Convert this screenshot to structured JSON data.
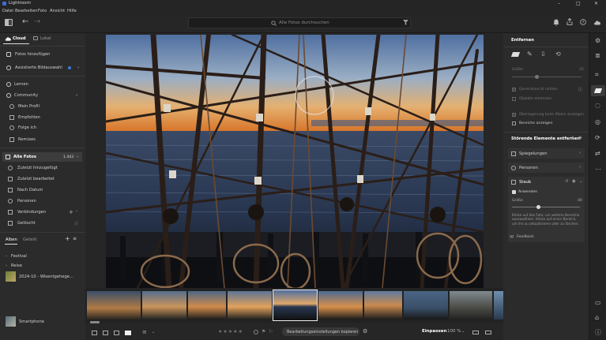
{
  "app": {
    "title": "Lightroom"
  },
  "menu": [
    "Datei",
    "Bearbeiten",
    "Foto",
    "Ansicht",
    "Hilfe"
  ],
  "search": {
    "placeholder": "Alle Fotos durchsuchen"
  },
  "left": {
    "tabs": {
      "cloud": "Cloud",
      "local": "Lokal"
    },
    "add_photos": "Fotos hinzufügen",
    "assisted": "Assistierte Bildauswahl",
    "learn": "Lernen",
    "community": "Community",
    "community_items": [
      "Mein Profil",
      "Empfohlen",
      "Folge ich",
      "Remixes"
    ],
    "all_photos": {
      "label": "Alle Fotos",
      "count": "1.443"
    },
    "library_items": [
      "Zuletzt hinzugefügt",
      "Zuletzt bearbeitet",
      "Nach Datum",
      "Personen",
      "Verbindungen",
      "Gelöscht"
    ],
    "album_tabs": {
      "albums": "Alben",
      "shared": "Geteilt"
    },
    "albums": [
      "Festival",
      "Reise",
      "2024-10 - Wisentgehege...",
      "Smartphone"
    ]
  },
  "right": {
    "panel_title": "Entfernen",
    "size_label": "Größe",
    "size_value": "25",
    "generative_ai": "Generative AI nutzen",
    "objects_detect": "Objekte erkennen",
    "reuse_label": "Überlagerung beim Malen anzeigen",
    "show_areas": "Bereiche anzeigen",
    "distracting_title": "Störende Elemente entfernen",
    "reflections": "Spiegelungen",
    "people": "Personen",
    "dust": "Staub",
    "apply": "Anwenden",
    "dust_size_label": "Größe",
    "dust_size_value": "40",
    "help_text": "Klicke auf das Foto, um weitere Bereiche auszuwählen. Klicke auf einen Bereich, um ihn zu aktualisieren oder zu löschen.",
    "feedback": "Feedback"
  },
  "bottom": {
    "copy_settings": "Bearbeitungseinstellungen kopieren",
    "fit": "Einpassen",
    "zoom": "100 %"
  },
  "colors": {
    "accent": "#3d7bd9",
    "panel": "#2b2b2b",
    "background": "#1a1a1a"
  }
}
